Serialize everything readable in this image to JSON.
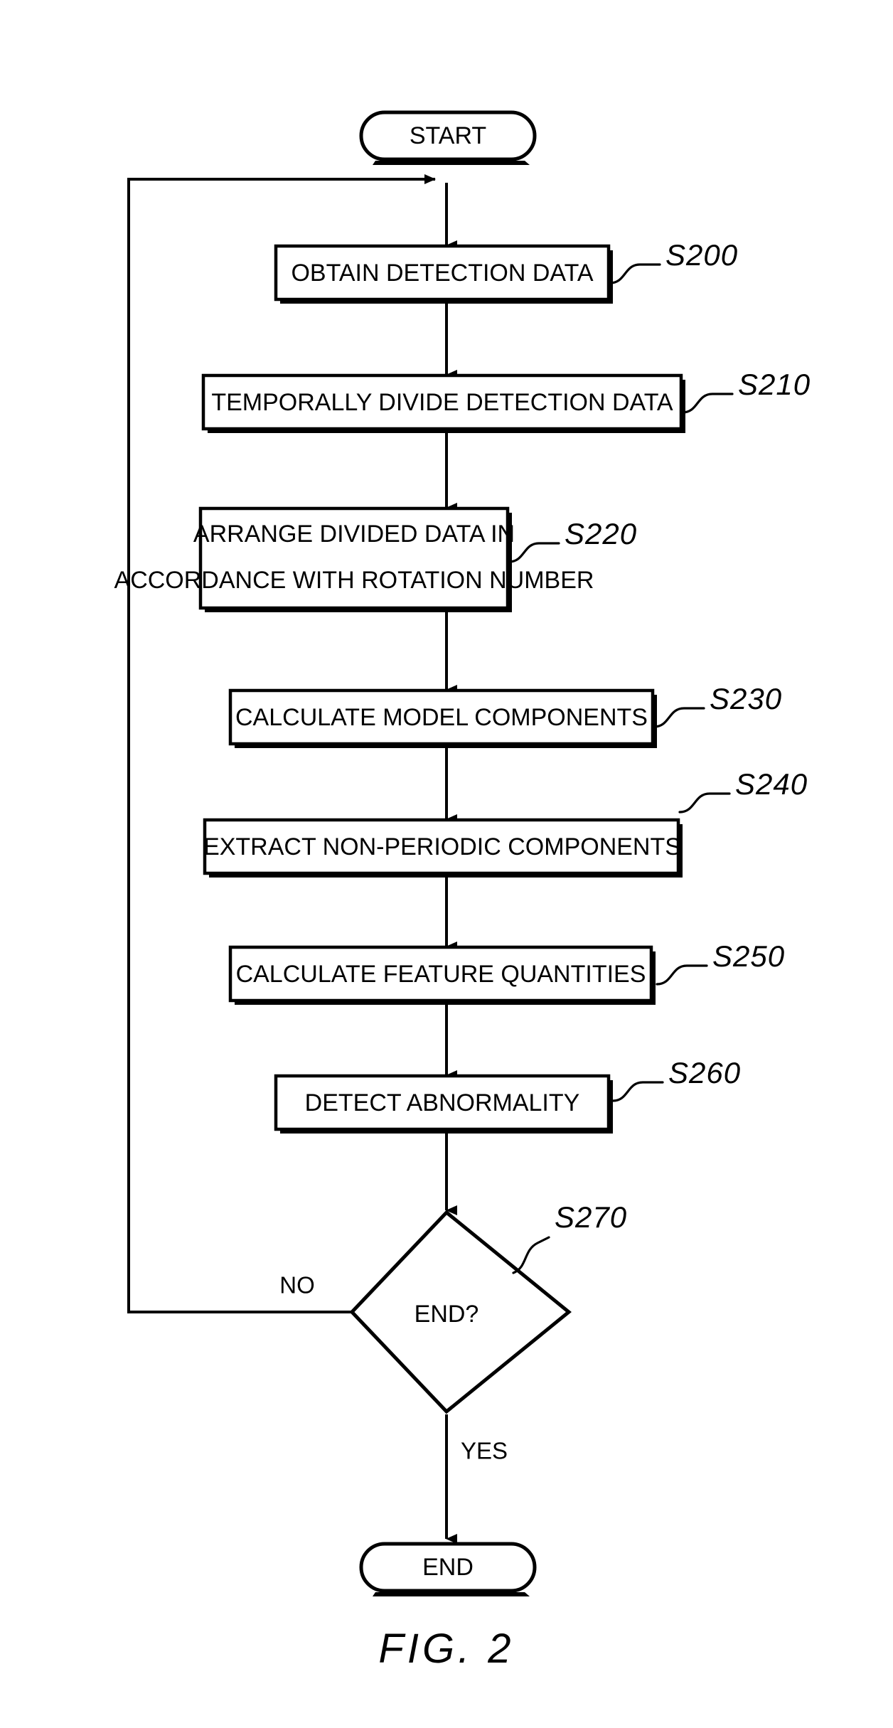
{
  "figure": {
    "caption": "FIG. 2",
    "type": "patent-flowchart"
  },
  "flowchart": {
    "start_terminal": {
      "label": "START",
      "shape": "rounded-terminal"
    },
    "end_terminal": {
      "label": "END",
      "shape": "rounded-terminal"
    },
    "steps": [
      {
        "ref": "S200",
        "shape": "process",
        "lines": [
          "OBTAIN DETECTION DATA"
        ]
      },
      {
        "ref": "S210",
        "shape": "process",
        "lines": [
          "TEMPORALLY DIVIDE DETECTION DATA"
        ]
      },
      {
        "ref": "S220",
        "shape": "process",
        "lines": [
          "ARRANGE DIVIDED DATA IN",
          "ACCORDANCE WITH ROTATION NUMBER"
        ]
      },
      {
        "ref": "S230",
        "shape": "process",
        "lines": [
          "CALCULATE MODEL COMPONENTS"
        ]
      },
      {
        "ref": "S240",
        "shape": "process",
        "lines": [
          "EXTRACT NON-PERIODIC COMPONENTS"
        ]
      },
      {
        "ref": "S250",
        "shape": "process",
        "lines": [
          "CALCULATE FEATURE QUANTITIES"
        ]
      },
      {
        "ref": "S260",
        "shape": "process",
        "lines": [
          "DETECT ABNORMALITY"
        ]
      }
    ],
    "decision": {
      "ref": "S270",
      "shape": "diamond",
      "label": "END?",
      "no_branch_label": "NO",
      "yes_branch_label": "YES"
    }
  },
  "colors": {
    "ink": "#000000",
    "paper": "#ffffff"
  }
}
